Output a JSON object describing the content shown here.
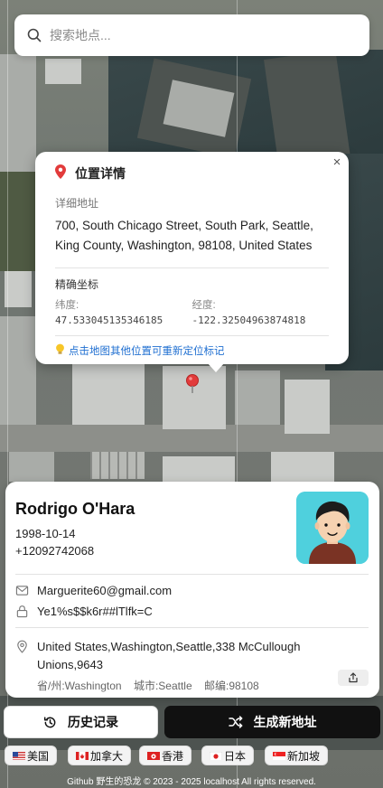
{
  "search": {
    "placeholder": "搜索地点..."
  },
  "popup": {
    "title": "位置详情",
    "address_label": "详细地址",
    "address": "700, South Chicago Street, South Park, Seattle, King County, Washington, 98108, United States",
    "coords_label": "精确坐标",
    "lat_label": "纬度:",
    "lat": "47.533045135346185",
    "lng_label": "经度:",
    "lng": "-122.32504963874818",
    "hint": "点击地图其他位置可重新定位标记",
    "close_symbol": "×"
  },
  "person": {
    "name": "Rodrigo O'Hara",
    "dob": "1998-10-14",
    "phone": "+12092742068",
    "email": "Marguerite60@gmail.com",
    "password": "Ye1%s$$k6r##lTlfk=C",
    "address": "United States,Washington,Seattle,338 McCullough Unions,9643",
    "state": "省/州:Washington",
    "city": "城市:Seattle",
    "zip": "邮编:98108"
  },
  "actions": {
    "history_label": "历史记录",
    "generate_label": "生成新地址"
  },
  "countries": [
    {
      "label": "美国"
    },
    {
      "label": "加拿大"
    },
    {
      "label": "香港"
    },
    {
      "label": "日本"
    },
    {
      "label": "新加坡"
    }
  ],
  "footer": "Github 野生的恐龙 © 2023 - 2025 localhost All rights reserved.",
  "colors": {
    "accent_link": "#1f6fd1",
    "generate_button_bg": "#111111",
    "avatar_bg": "#4fd0dd",
    "marker": "#e23b3b"
  },
  "icons": [
    "search-icon",
    "pin-icon",
    "close-icon",
    "bulb-icon",
    "mail-icon",
    "lock-icon",
    "location-icon",
    "share-icon",
    "history-icon",
    "shuffle-icon"
  ]
}
